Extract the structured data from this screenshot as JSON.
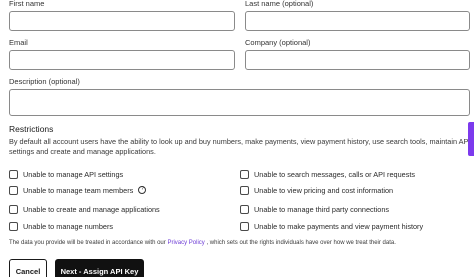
{
  "form": {
    "first_name_label": "First name",
    "last_name_label": "Last name (optional)",
    "email_label": "Email",
    "company_label": "Company (optional)",
    "description_label": "Description (optional)"
  },
  "restrictions": {
    "title": "Restrictions",
    "description": "By default all account users have the ability to look up and buy numbers, make payments, view payment history, use search tools, maintain API settings and create and manage applications.",
    "options_left": [
      "Unable to manage API settings",
      "Unable to manage team members",
      "Unable to create and manage applications",
      "Unable to manage numbers"
    ],
    "options_right": [
      "Unable to search messages, calls or API requests",
      "Unable to view pricing and cost information",
      "Unable to manage third party connections",
      "Unable to make payments and view payment history"
    ]
  },
  "notice": {
    "before": "The data you provide will be treated in accordance with our ",
    "link": "Privacy Policy",
    "after": " , which sets out the rights individuals have over how we treat their data."
  },
  "buttons": {
    "cancel": "Cancel",
    "next": "Next - Assign API Key"
  },
  "colors": {
    "accent": "#7c3aed",
    "primary_button": "#111111"
  },
  "icons": {
    "help": "question-circle-icon"
  }
}
